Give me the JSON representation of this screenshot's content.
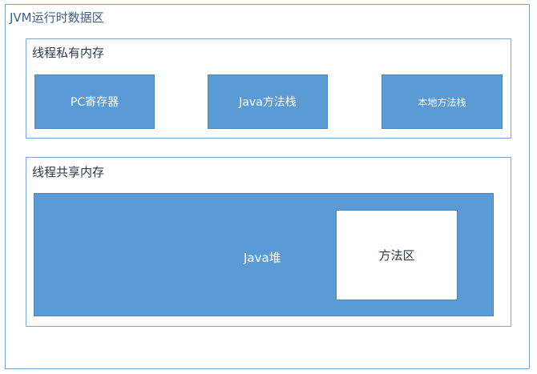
{
  "diagram": {
    "title": "JVM运行时数据区",
    "private_memory": {
      "title": "线程私有内存",
      "blocks": [
        "PC寄存器",
        "Java方法栈",
        "本地方法栈"
      ]
    },
    "shared_memory": {
      "title": "线程共享内存",
      "heap_label": "Java堆",
      "method_area_label": "方法区"
    }
  },
  "colors": {
    "block_fill": "#5b9bd5",
    "block_border": "#4f86b8",
    "panel_border": "#7ea3c8",
    "title_text": "#3f5f86",
    "panel_title_text": "#2e3a4a",
    "inner_white_box": "#ffffff"
  }
}
